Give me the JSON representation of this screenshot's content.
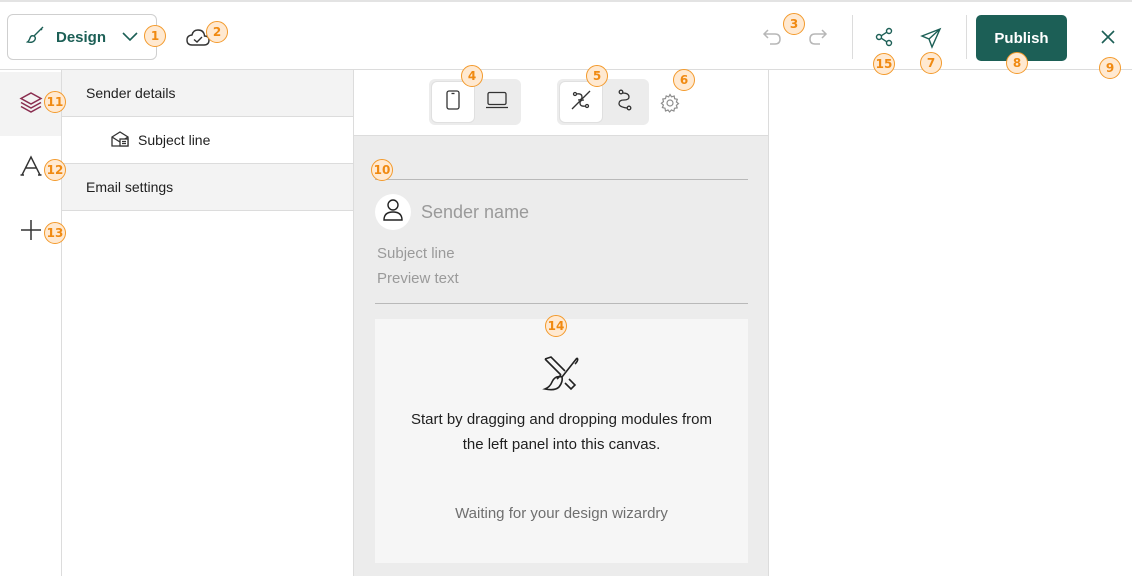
{
  "toolbar": {
    "design_label": "Design",
    "publish_label": "Publish"
  },
  "tree": {
    "items": [
      {
        "label": "Sender details",
        "type": "group"
      },
      {
        "label": "Subject line",
        "type": "child"
      },
      {
        "label": "Email settings",
        "type": "group"
      }
    ]
  },
  "canvas": {
    "sender_name": "Sender name",
    "subject_line": "Subject line",
    "preview_text": "Preview text",
    "drop_message": "Start by dragging and dropping modules from the left panel into this canvas.",
    "waiting_message": "Waiting for your design wizardry"
  },
  "badges": [
    "1",
    "2",
    "3",
    "4",
    "5",
    "6",
    "7",
    "8",
    "9",
    "10",
    "11",
    "12",
    "13",
    "14",
    "15"
  ],
  "colors": {
    "brand": "#1c5f56",
    "badge_border": "#f39a2c",
    "badge_fill": "#ffe9d1",
    "layers_icon": "#8a2d4f"
  },
  "icons": {
    "design": "paintbrush-icon",
    "saved": "cloud-check-icon",
    "undo": "undo-icon",
    "redo": "redo-icon",
    "share": "share-icon",
    "send_test": "send-icon",
    "close": "close-icon",
    "mobile": "mobile-icon",
    "desktop": "desktop-icon",
    "link_off": "link-off-icon",
    "path": "path-icon",
    "settings": "gear-icon",
    "layers": "layers-icon",
    "text_style": "typography-icon",
    "add": "plus-icon",
    "avatar": "user-icon",
    "drop": "paint-tools-icon"
  }
}
